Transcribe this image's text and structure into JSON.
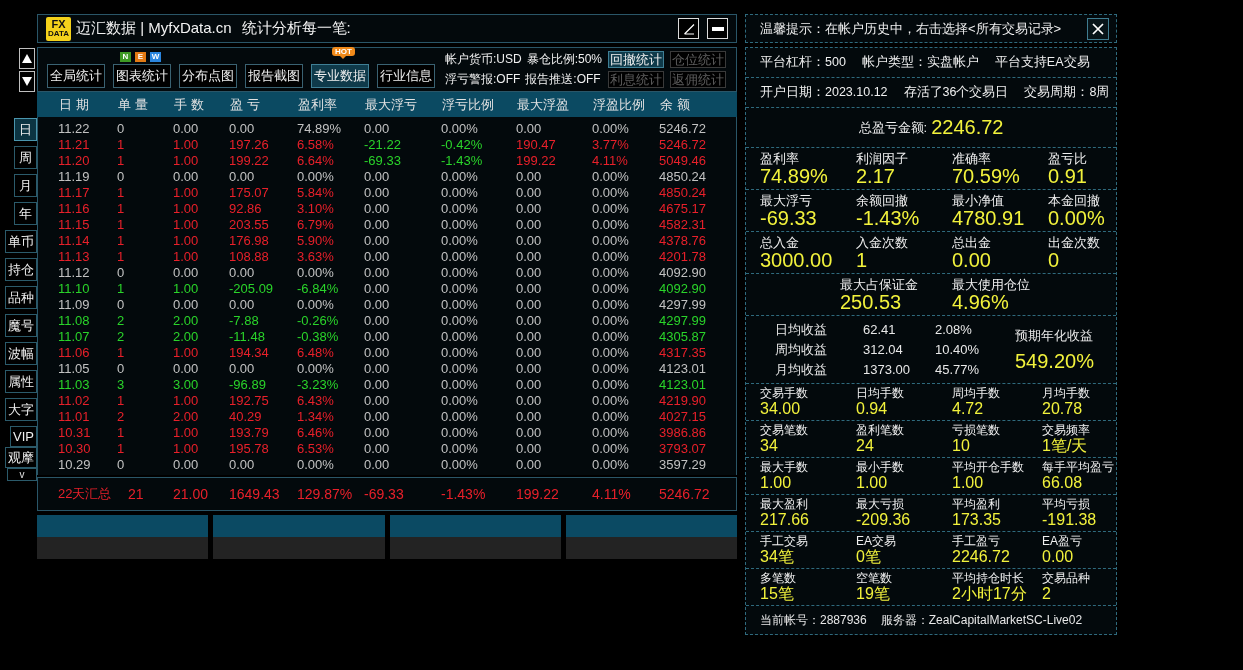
{
  "title_bar": {
    "logo": {
      "line_1": "FX",
      "line_2": "DATA"
    },
    "title": "迈汇数据 | MyfxData.cn",
    "subtitle": "统计分析每一笔:"
  },
  "side_tabs": [
    {
      "label": "日",
      "selected": true
    },
    {
      "label": "周",
      "selected": false
    },
    {
      "label": "月",
      "selected": false
    },
    {
      "label": "年",
      "selected": false
    },
    {
      "label": "单币",
      "selected": false
    },
    {
      "label": "持仓",
      "selected": false
    },
    {
      "label": "品种",
      "selected": false
    },
    {
      "label": "魔号",
      "selected": false
    },
    {
      "label": "波幅",
      "selected": false
    },
    {
      "label": "属性",
      "selected": false
    },
    {
      "label": "大字",
      "selected": false
    },
    {
      "label": "VIP",
      "selected": false
    },
    {
      "label": "观摩",
      "selected": false
    }
  ],
  "side_more": "v",
  "toolbar": {
    "tabs": [
      {
        "label": "全局统计",
        "selected": false
      },
      {
        "label": "图表统计",
        "selected": false,
        "badge": {
          "kind": "letters",
          "letters": [
            {
              "text": "N",
              "color": "#3e9a24"
            },
            {
              "text": "E",
              "color": "#e27a14"
            },
            {
              "text": "W",
              "color": "#2a86e0"
            }
          ]
        }
      },
      {
        "label": "分布点图",
        "selected": false
      },
      {
        "label": "报告截图",
        "selected": false
      },
      {
        "label": "专业数据",
        "selected": true,
        "badge": {
          "kind": "tag",
          "text": "HOT"
        }
      },
      {
        "label": "行业信息",
        "selected": false
      }
    ],
    "account_flags": [
      [
        "帐户货币:USD",
        "暴仓比例:50%"
      ],
      [
        "浮亏警报:OFF",
        "报告推送:OFF"
      ]
    ],
    "stat_buttons": [
      {
        "label": "回撤统计",
        "selected": true
      },
      {
        "label": "仓位统计",
        "selected": false
      },
      {
        "label": "利息统计",
        "selected": false
      },
      {
        "label": "返佣统计",
        "selected": false
      }
    ]
  },
  "table": {
    "columns": [
      "日 期",
      "单 量",
      "手 数",
      "盈 亏",
      "盈利率",
      "最大浮亏",
      "浮亏比例",
      "最大浮盈",
      "浮盈比例",
      "余 额"
    ],
    "rows": [
      {
        "cells": [
          {
            "text": "11.22",
            "color": "#c2c2c2"
          },
          {
            "text": "0",
            "color": "#c2c2c2"
          },
          {
            "text": "0.00",
            "color": "#c2c2c2"
          },
          {
            "text": "0.00",
            "color": "#c2c2c2"
          },
          {
            "text": "74.89%",
            "color": "#c2c2c2"
          },
          {
            "text": "0.00",
            "color": "#c2c2c2"
          },
          {
            "text": "0.00%",
            "color": "#c2c2c2"
          },
          {
            "text": "0.00",
            "color": "#c2c2c2"
          },
          {
            "text": "0.00%",
            "color": "#c2c2c2"
          },
          {
            "text": "5246.72",
            "color": "#c2c2c2"
          }
        ]
      },
      {
        "cells": [
          {
            "text": "11.21",
            "color": "#e8202a"
          },
          {
            "text": "1",
            "color": "#e8202a"
          },
          {
            "text": "1.00",
            "color": "#e8202a"
          },
          {
            "text": "197.26",
            "color": "#e8202a"
          },
          {
            "text": "6.58%",
            "color": "#e8202a"
          },
          {
            "text": "-21.22",
            "color": "#2ad42a"
          },
          {
            "text": "-0.42%",
            "color": "#2ad42a"
          },
          {
            "text": "190.47",
            "color": "#e8202a"
          },
          {
            "text": "3.77%",
            "color": "#e8202a"
          },
          {
            "text": "5246.72",
            "color": "#e8202a"
          }
        ]
      },
      {
        "cells": [
          {
            "text": "11.20",
            "color": "#e8202a"
          },
          {
            "text": "1",
            "color": "#e8202a"
          },
          {
            "text": "1.00",
            "color": "#e8202a"
          },
          {
            "text": "199.22",
            "color": "#e8202a"
          },
          {
            "text": "6.64%",
            "color": "#e8202a"
          },
          {
            "text": "-69.33",
            "color": "#2ad42a"
          },
          {
            "text": "-1.43%",
            "color": "#2ad42a"
          },
          {
            "text": "199.22",
            "color": "#e8202a"
          },
          {
            "text": "4.11%",
            "color": "#e8202a"
          },
          {
            "text": "5049.46",
            "color": "#e8202a"
          }
        ]
      },
      {
        "cells": [
          {
            "text": "11.19",
            "color": "#c2c2c2"
          },
          {
            "text": "0",
            "color": "#c2c2c2"
          },
          {
            "text": "0.00",
            "color": "#c2c2c2"
          },
          {
            "text": "0.00",
            "color": "#c2c2c2"
          },
          {
            "text": "0.00%",
            "color": "#c2c2c2"
          },
          {
            "text": "0.00",
            "color": "#c2c2c2"
          },
          {
            "text": "0.00%",
            "color": "#c2c2c2"
          },
          {
            "text": "0.00",
            "color": "#c2c2c2"
          },
          {
            "text": "0.00%",
            "color": "#c2c2c2"
          },
          {
            "text": "4850.24",
            "color": "#c2c2c2"
          }
        ]
      },
      {
        "cells": [
          {
            "text": "11.17",
            "color": "#e8202a"
          },
          {
            "text": "1",
            "color": "#e8202a"
          },
          {
            "text": "1.00",
            "color": "#e8202a"
          },
          {
            "text": "175.07",
            "color": "#e8202a"
          },
          {
            "text": "5.84%",
            "color": "#e8202a"
          },
          {
            "text": "0.00",
            "color": "#c2c2c2"
          },
          {
            "text": "0.00%",
            "color": "#c2c2c2"
          },
          {
            "text": "0.00",
            "color": "#c2c2c2"
          },
          {
            "text": "0.00%",
            "color": "#c2c2c2"
          },
          {
            "text": "4850.24",
            "color": "#e8202a"
          }
        ]
      },
      {
        "cells": [
          {
            "text": "11.16",
            "color": "#e8202a"
          },
          {
            "text": "1",
            "color": "#e8202a"
          },
          {
            "text": "1.00",
            "color": "#e8202a"
          },
          {
            "text": "92.86",
            "color": "#e8202a"
          },
          {
            "text": "3.10%",
            "color": "#e8202a"
          },
          {
            "text": "0.00",
            "color": "#c2c2c2"
          },
          {
            "text": "0.00%",
            "color": "#c2c2c2"
          },
          {
            "text": "0.00",
            "color": "#c2c2c2"
          },
          {
            "text": "0.00%",
            "color": "#c2c2c2"
          },
          {
            "text": "4675.17",
            "color": "#e8202a"
          }
        ]
      },
      {
        "cells": [
          {
            "text": "11.15",
            "color": "#e8202a"
          },
          {
            "text": "1",
            "color": "#e8202a"
          },
          {
            "text": "1.00",
            "color": "#e8202a"
          },
          {
            "text": "203.55",
            "color": "#e8202a"
          },
          {
            "text": "6.79%",
            "color": "#e8202a"
          },
          {
            "text": "0.00",
            "color": "#c2c2c2"
          },
          {
            "text": "0.00%",
            "color": "#c2c2c2"
          },
          {
            "text": "0.00",
            "color": "#c2c2c2"
          },
          {
            "text": "0.00%",
            "color": "#c2c2c2"
          },
          {
            "text": "4582.31",
            "color": "#e8202a"
          }
        ]
      },
      {
        "cells": [
          {
            "text": "11.14",
            "color": "#e8202a"
          },
          {
            "text": "1",
            "color": "#e8202a"
          },
          {
            "text": "1.00",
            "color": "#e8202a"
          },
          {
            "text": "176.98",
            "color": "#e8202a"
          },
          {
            "text": "5.90%",
            "color": "#e8202a"
          },
          {
            "text": "0.00",
            "color": "#c2c2c2"
          },
          {
            "text": "0.00%",
            "color": "#c2c2c2"
          },
          {
            "text": "0.00",
            "color": "#c2c2c2"
          },
          {
            "text": "0.00%",
            "color": "#c2c2c2"
          },
          {
            "text": "4378.76",
            "color": "#e8202a"
          }
        ]
      },
      {
        "cells": [
          {
            "text": "11.13",
            "color": "#e8202a"
          },
          {
            "text": "1",
            "color": "#e8202a"
          },
          {
            "text": "1.00",
            "color": "#e8202a"
          },
          {
            "text": "108.88",
            "color": "#e8202a"
          },
          {
            "text": "3.63%",
            "color": "#e8202a"
          },
          {
            "text": "0.00",
            "color": "#c2c2c2"
          },
          {
            "text": "0.00%",
            "color": "#c2c2c2"
          },
          {
            "text": "0.00",
            "color": "#c2c2c2"
          },
          {
            "text": "0.00%",
            "color": "#c2c2c2"
          },
          {
            "text": "4201.78",
            "color": "#e8202a"
          }
        ]
      },
      {
        "cells": [
          {
            "text": "11.12",
            "color": "#c2c2c2"
          },
          {
            "text": "0",
            "color": "#c2c2c2"
          },
          {
            "text": "0.00",
            "color": "#c2c2c2"
          },
          {
            "text": "0.00",
            "color": "#c2c2c2"
          },
          {
            "text": "0.00%",
            "color": "#c2c2c2"
          },
          {
            "text": "0.00",
            "color": "#c2c2c2"
          },
          {
            "text": "0.00%",
            "color": "#c2c2c2"
          },
          {
            "text": "0.00",
            "color": "#c2c2c2"
          },
          {
            "text": "0.00%",
            "color": "#c2c2c2"
          },
          {
            "text": "4092.90",
            "color": "#c2c2c2"
          }
        ]
      },
      {
        "cells": [
          {
            "text": "11.10",
            "color": "#2ad42a"
          },
          {
            "text": "1",
            "color": "#2ad42a"
          },
          {
            "text": "1.00",
            "color": "#2ad42a"
          },
          {
            "text": "-205.09",
            "color": "#2ad42a"
          },
          {
            "text": "-6.84%",
            "color": "#2ad42a"
          },
          {
            "text": "0.00",
            "color": "#c2c2c2"
          },
          {
            "text": "0.00%",
            "color": "#c2c2c2"
          },
          {
            "text": "0.00",
            "color": "#c2c2c2"
          },
          {
            "text": "0.00%",
            "color": "#c2c2c2"
          },
          {
            "text": "4092.90",
            "color": "#2ad42a"
          }
        ]
      },
      {
        "cells": [
          {
            "text": "11.09",
            "color": "#c2c2c2"
          },
          {
            "text": "0",
            "color": "#c2c2c2"
          },
          {
            "text": "0.00",
            "color": "#c2c2c2"
          },
          {
            "text": "0.00",
            "color": "#c2c2c2"
          },
          {
            "text": "0.00%",
            "color": "#c2c2c2"
          },
          {
            "text": "0.00",
            "color": "#c2c2c2"
          },
          {
            "text": "0.00%",
            "color": "#c2c2c2"
          },
          {
            "text": "0.00",
            "color": "#c2c2c2"
          },
          {
            "text": "0.00%",
            "color": "#c2c2c2"
          },
          {
            "text": "4297.99",
            "color": "#c2c2c2"
          }
        ]
      },
      {
        "cells": [
          {
            "text": "11.08",
            "color": "#2ad42a"
          },
          {
            "text": "2",
            "color": "#2ad42a"
          },
          {
            "text": "2.00",
            "color": "#2ad42a"
          },
          {
            "text": "-7.88",
            "color": "#2ad42a"
          },
          {
            "text": "-0.26%",
            "color": "#2ad42a"
          },
          {
            "text": "0.00",
            "color": "#c2c2c2"
          },
          {
            "text": "0.00%",
            "color": "#c2c2c2"
          },
          {
            "text": "0.00",
            "color": "#c2c2c2"
          },
          {
            "text": "0.00%",
            "color": "#c2c2c2"
          },
          {
            "text": "4297.99",
            "color": "#2ad42a"
          }
        ]
      },
      {
        "cells": [
          {
            "text": "11.07",
            "color": "#2ad42a"
          },
          {
            "text": "2",
            "color": "#2ad42a"
          },
          {
            "text": "2.00",
            "color": "#2ad42a"
          },
          {
            "text": "-11.48",
            "color": "#2ad42a"
          },
          {
            "text": "-0.38%",
            "color": "#2ad42a"
          },
          {
            "text": "0.00",
            "color": "#c2c2c2"
          },
          {
            "text": "0.00%",
            "color": "#c2c2c2"
          },
          {
            "text": "0.00",
            "color": "#c2c2c2"
          },
          {
            "text": "0.00%",
            "color": "#c2c2c2"
          },
          {
            "text": "4305.87",
            "color": "#2ad42a"
          }
        ]
      },
      {
        "cells": [
          {
            "text": "11.06",
            "color": "#e8202a"
          },
          {
            "text": "1",
            "color": "#e8202a"
          },
          {
            "text": "1.00",
            "color": "#e8202a"
          },
          {
            "text": "194.34",
            "color": "#e8202a"
          },
          {
            "text": "6.48%",
            "color": "#e8202a"
          },
          {
            "text": "0.00",
            "color": "#c2c2c2"
          },
          {
            "text": "0.00%",
            "color": "#c2c2c2"
          },
          {
            "text": "0.00",
            "color": "#c2c2c2"
          },
          {
            "text": "0.00%",
            "color": "#c2c2c2"
          },
          {
            "text": "4317.35",
            "color": "#e8202a"
          }
        ]
      },
      {
        "cells": [
          {
            "text": "11.05",
            "color": "#c2c2c2"
          },
          {
            "text": "0",
            "color": "#c2c2c2"
          },
          {
            "text": "0.00",
            "color": "#c2c2c2"
          },
          {
            "text": "0.00",
            "color": "#c2c2c2"
          },
          {
            "text": "0.00%",
            "color": "#c2c2c2"
          },
          {
            "text": "0.00",
            "color": "#c2c2c2"
          },
          {
            "text": "0.00%",
            "color": "#c2c2c2"
          },
          {
            "text": "0.00",
            "color": "#c2c2c2"
          },
          {
            "text": "0.00%",
            "color": "#c2c2c2"
          },
          {
            "text": "4123.01",
            "color": "#c2c2c2"
          }
        ]
      },
      {
        "cells": [
          {
            "text": "11.03",
            "color": "#2ad42a"
          },
          {
            "text": "3",
            "color": "#2ad42a"
          },
          {
            "text": "3.00",
            "color": "#2ad42a"
          },
          {
            "text": "-96.89",
            "color": "#2ad42a"
          },
          {
            "text": "-3.23%",
            "color": "#2ad42a"
          },
          {
            "text": "0.00",
            "color": "#c2c2c2"
          },
          {
            "text": "0.00%",
            "color": "#c2c2c2"
          },
          {
            "text": "0.00",
            "color": "#c2c2c2"
          },
          {
            "text": "0.00%",
            "color": "#c2c2c2"
          },
          {
            "text": "4123.01",
            "color": "#2ad42a"
          }
        ]
      },
      {
        "cells": [
          {
            "text": "11.02",
            "color": "#e8202a"
          },
          {
            "text": "1",
            "color": "#e8202a"
          },
          {
            "text": "1.00",
            "color": "#e8202a"
          },
          {
            "text": "192.75",
            "color": "#e8202a"
          },
          {
            "text": "6.43%",
            "color": "#e8202a"
          },
          {
            "text": "0.00",
            "color": "#c2c2c2"
          },
          {
            "text": "0.00%",
            "color": "#c2c2c2"
          },
          {
            "text": "0.00",
            "color": "#c2c2c2"
          },
          {
            "text": "0.00%",
            "color": "#c2c2c2"
          },
          {
            "text": "4219.90",
            "color": "#e8202a"
          }
        ]
      },
      {
        "cells": [
          {
            "text": "11.01",
            "color": "#e8202a"
          },
          {
            "text": "2",
            "color": "#e8202a"
          },
          {
            "text": "2.00",
            "color": "#e8202a"
          },
          {
            "text": "40.29",
            "color": "#e8202a"
          },
          {
            "text": "1.34%",
            "color": "#e8202a"
          },
          {
            "text": "0.00",
            "color": "#c2c2c2"
          },
          {
            "text": "0.00%",
            "color": "#c2c2c2"
          },
          {
            "text": "0.00",
            "color": "#c2c2c2"
          },
          {
            "text": "0.00%",
            "color": "#c2c2c2"
          },
          {
            "text": "4027.15",
            "color": "#e8202a"
          }
        ]
      },
      {
        "cells": [
          {
            "text": "10.31",
            "color": "#e8202a"
          },
          {
            "text": "1",
            "color": "#e8202a"
          },
          {
            "text": "1.00",
            "color": "#e8202a"
          },
          {
            "text": "193.79",
            "color": "#e8202a"
          },
          {
            "text": "6.46%",
            "color": "#e8202a"
          },
          {
            "text": "0.00",
            "color": "#c2c2c2"
          },
          {
            "text": "0.00%",
            "color": "#c2c2c2"
          },
          {
            "text": "0.00",
            "color": "#c2c2c2"
          },
          {
            "text": "0.00%",
            "color": "#c2c2c2"
          },
          {
            "text": "3986.86",
            "color": "#e8202a"
          }
        ]
      },
      {
        "cells": [
          {
            "text": "10.30",
            "color": "#e8202a"
          },
          {
            "text": "1",
            "color": "#e8202a"
          },
          {
            "text": "1.00",
            "color": "#e8202a"
          },
          {
            "text": "195.78",
            "color": "#e8202a"
          },
          {
            "text": "6.53%",
            "color": "#e8202a"
          },
          {
            "text": "0.00",
            "color": "#c2c2c2"
          },
          {
            "text": "0.00%",
            "color": "#c2c2c2"
          },
          {
            "text": "0.00",
            "color": "#c2c2c2"
          },
          {
            "text": "0.00%",
            "color": "#c2c2c2"
          },
          {
            "text": "3793.07",
            "color": "#e8202a"
          }
        ]
      },
      {
        "cells": [
          {
            "text": "10.29",
            "color": "#c2c2c2"
          },
          {
            "text": "0",
            "color": "#c2c2c2"
          },
          {
            "text": "0.00",
            "color": "#c2c2c2"
          },
          {
            "text": "0.00",
            "color": "#c2c2c2"
          },
          {
            "text": "0.00%",
            "color": "#c2c2c2"
          },
          {
            "text": "0.00",
            "color": "#c2c2c2"
          },
          {
            "text": "0.00%",
            "color": "#c2c2c2"
          },
          {
            "text": "0.00",
            "color": "#c2c2c2"
          },
          {
            "text": "0.00%",
            "color": "#c2c2c2"
          },
          {
            "text": "3597.29",
            "color": "#c2c2c2"
          }
        ]
      }
    ],
    "summary": [
      "22天汇总",
      "21",
      "21.00",
      "1649.43",
      "129.87%",
      "-69.33",
      "-1.43%",
      "199.22",
      "4.11%",
      "5246.72"
    ]
  },
  "info_panel": {
    "notice": "温馨提示：在帐户历史中，右击选择<所有交易记录>",
    "account_rows": [
      [
        "平台杠杆：500",
        "帐户类型：实盘帐户",
        "平台支持EA交易"
      ],
      [
        "开户日期：2023.10.12",
        "存活了36个交易日",
        "交易周期：8周"
      ]
    ],
    "total": {
      "label": "总盈亏金额:",
      "value": "2246.72"
    },
    "key_stats": [
      [
        {
          "label": "盈利率",
          "value": "74.89%"
        },
        {
          "label": "利润因子",
          "value": "2.17"
        },
        {
          "label": "准确率",
          "value": "70.59%"
        },
        {
          "label": "盈亏比",
          "value": "0.91"
        }
      ],
      [
        {
          "label": "最大浮亏",
          "value": "-69.33"
        },
        {
          "label": "余额回撤",
          "value": "-1.43%"
        },
        {
          "label": "最小净值",
          "value": "4780.91"
        },
        {
          "label": "本金回撤",
          "value": "0.00%"
        }
      ],
      [
        {
          "label": "总入金",
          "value": "3000.00"
        },
        {
          "label": "入金次数",
          "value": "1"
        },
        {
          "label": "总出金",
          "value": "0.00"
        },
        {
          "label": "出金次数",
          "value": "0"
        }
      ],
      [
        {
          "label": "最大占保证金",
          "value": "250.53"
        },
        {
          "label": "最大使用仓位",
          "value": "4.96%"
        }
      ]
    ],
    "averages": [
      {
        "label": "日均收益",
        "amount": "62.41",
        "percent": "2.08%"
      },
      {
        "label": "周均收益",
        "amount": "312.04",
        "percent": "10.40%"
      },
      {
        "label": "月均收益",
        "amount": "1373.00",
        "percent": "45.77%"
      }
    ],
    "annualized": {
      "label": "预期年化收益",
      "value": "549.20%"
    },
    "trade_stats": [
      [
        {
          "label": "交易手数",
          "value": "34.00"
        },
        {
          "label": "日均手数",
          "value": "0.94"
        },
        {
          "label": "周均手数",
          "value": "4.72"
        },
        {
          "label": "月均手数",
          "value": "20.78"
        }
      ],
      [
        {
          "label": "交易笔数",
          "value": "34"
        },
        {
          "label": "盈利笔数",
          "value": "24"
        },
        {
          "label": "亏损笔数",
          "value": "10"
        },
        {
          "label": "交易频率",
          "value": "1笔/天"
        }
      ],
      [
        {
          "label": "最大手数",
          "value": "1.00"
        },
        {
          "label": "最小手数",
          "value": "1.00"
        },
        {
          "label": "平均开仓手数",
          "value": "1.00"
        },
        {
          "label": "每手平均盈亏",
          "value": "66.08"
        }
      ],
      [
        {
          "label": "最大盈利",
          "value": "217.66"
        },
        {
          "label": "最大亏损",
          "value": "-209.36"
        },
        {
          "label": "平均盈利",
          "value": "173.35"
        },
        {
          "label": "平均亏损",
          "value": "-191.38"
        }
      ],
      [
        {
          "label": "手工交易",
          "value": "34笔"
        },
        {
          "label": "EA交易",
          "value": "0笔"
        },
        {
          "label": "手工盈亏",
          "value": "2246.72"
        },
        {
          "label": "EA盈亏",
          "value": "0.00"
        }
      ],
      [
        {
          "label": "多笔数",
          "value": "15笔"
        },
        {
          "label": "空笔数",
          "value": "19笔"
        },
        {
          "label": "平均持仓时长",
          "value": "2小时17分"
        },
        {
          "label": "交易品种",
          "value": "2"
        }
      ]
    ],
    "footer": [
      "当前帐号：2887936",
      "服务器：ZealCapitalMarketSC-Live02"
    ]
  }
}
